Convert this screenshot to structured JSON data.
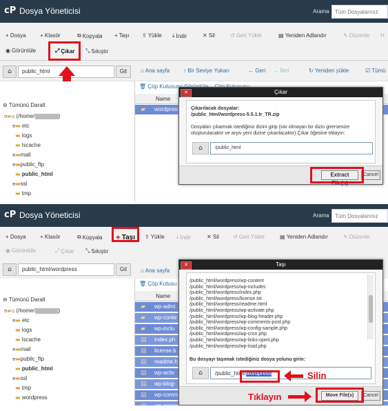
{
  "app": {
    "logo_glyph": "cP",
    "title": "Dosya Yöneticisi",
    "search_label": "Arama",
    "search_scope": "Tüm Dosyalarınız"
  },
  "toolbar_1": {
    "row1": [
      "+ Dosya",
      "+ Klasör",
      "Kopyala",
      "+ Taşı",
      "Yükle",
      "İndir",
      "✕ Sil",
      "Geri Yükle",
      "Yeniden Adlandır",
      "Düzenle",
      "H"
    ],
    "row2": [
      "Görüntüle",
      "Çıkar",
      "Sıkıştır"
    ]
  },
  "toolbar_2": {
    "row1": [
      "+ Dosya",
      "+ Klasör",
      "Kopyala",
      "Taşı",
      "Yükle",
      "İndir",
      "✕ Sil",
      "Geri Yükle",
      "Yeniden Adlandır",
      "Düzenle"
    ],
    "row2": [
      "Görüntüle",
      "Çıkar",
      "Sıkıştır"
    ]
  },
  "panel1": {
    "path": "public_html",
    "go": "Git",
    "nav": [
      "Ana sayfa",
      "Bir Seviye Yukarı",
      "Geri",
      "İleri",
      "Yeniden yükle",
      "Tümü"
    ],
    "subnav": [
      "Çöp Kutusunu Görüntüle",
      "Çöp Kutusunu"
    ],
    "collapse_all": "Tümünü Daralt",
    "tree": [
      "(/home/",
      "etc",
      "logs",
      "lscache",
      "mail",
      "public_ftp",
      "public_html",
      "ssl",
      "tmp"
    ],
    "col_name": "Name",
    "files": [
      "wordpress"
    ],
    "dialog": {
      "title": "Çıkar",
      "files_label": "Çıkarılacak dosyalar:",
      "file_path": "/public_html/wordpress-5.5.1.tr_TR.zip",
      "instructions": "Dosyaları çıkarmak istediğiniz dizini girip (var olmayan bir dizin girersenize oluşturulacaktır ve arşiv yeni dizine çıkarılacaktır) Çıkar öğesine tıklayın:",
      "dest": "/public_html",
      "primary_btn": "Extract File(s)",
      "cancel_btn": "Cancel"
    }
  },
  "panel2": {
    "path": "public_html/wordpress",
    "go": "Git",
    "nav": [
      "Ana sayfa"
    ],
    "subnav": [
      "Çöp Kutusu"
    ],
    "collapse_all": "Tümünü Daralt",
    "tree": [
      "(/home/",
      "etc",
      "logs",
      "lscache",
      "mail",
      "public_ftp",
      "public_html",
      "ssl",
      "tmp",
      "wordpress"
    ],
    "col_name": "Name",
    "files": [
      "wp-admi",
      "wp-conte",
      "wp-inclu",
      "index.ph",
      "license.b",
      "readme.h",
      "wp-activ",
      "wp-blog-",
      "wp-comm",
      "wp-comm"
    ],
    "dialog": {
      "title": "Taşı",
      "files": [
        "/public_html/wordpress/wp-content",
        "/public_html/wordpress/wp-includes",
        "/public_html/wordpress/index.php",
        "/public_html/wordpress/license.txt",
        "/public_html/wordpress/readme.html",
        "/public_html/wordpress/wp-activate.php",
        "/public_html/wordpress/wp-blog-header.php",
        "/public_html/wordpress/wp-comments-post.php",
        "/public_html/wordpress/wp-config-sample.php",
        "/public_html/wordpress/wp-cron.php",
        "/public_html/wordpress/wp-links-opml.php",
        "/public_html/wordpress/wp-load.php"
      ],
      "dest_label": "Bu dosyayı taşımak istediğiniz dosya yolunu girin:",
      "dest_prefix": "/public_html/",
      "dest_selected": "wordpress",
      "primary_btn": "Move File(s)",
      "cancel_btn": "Cancel"
    },
    "annot_delete": "Silin",
    "annot_click": "Tıklayın"
  },
  "colors": {
    "header": "#293a4a",
    "accent_red": "#e0101c",
    "selection_blue": "#6d8bd6"
  }
}
